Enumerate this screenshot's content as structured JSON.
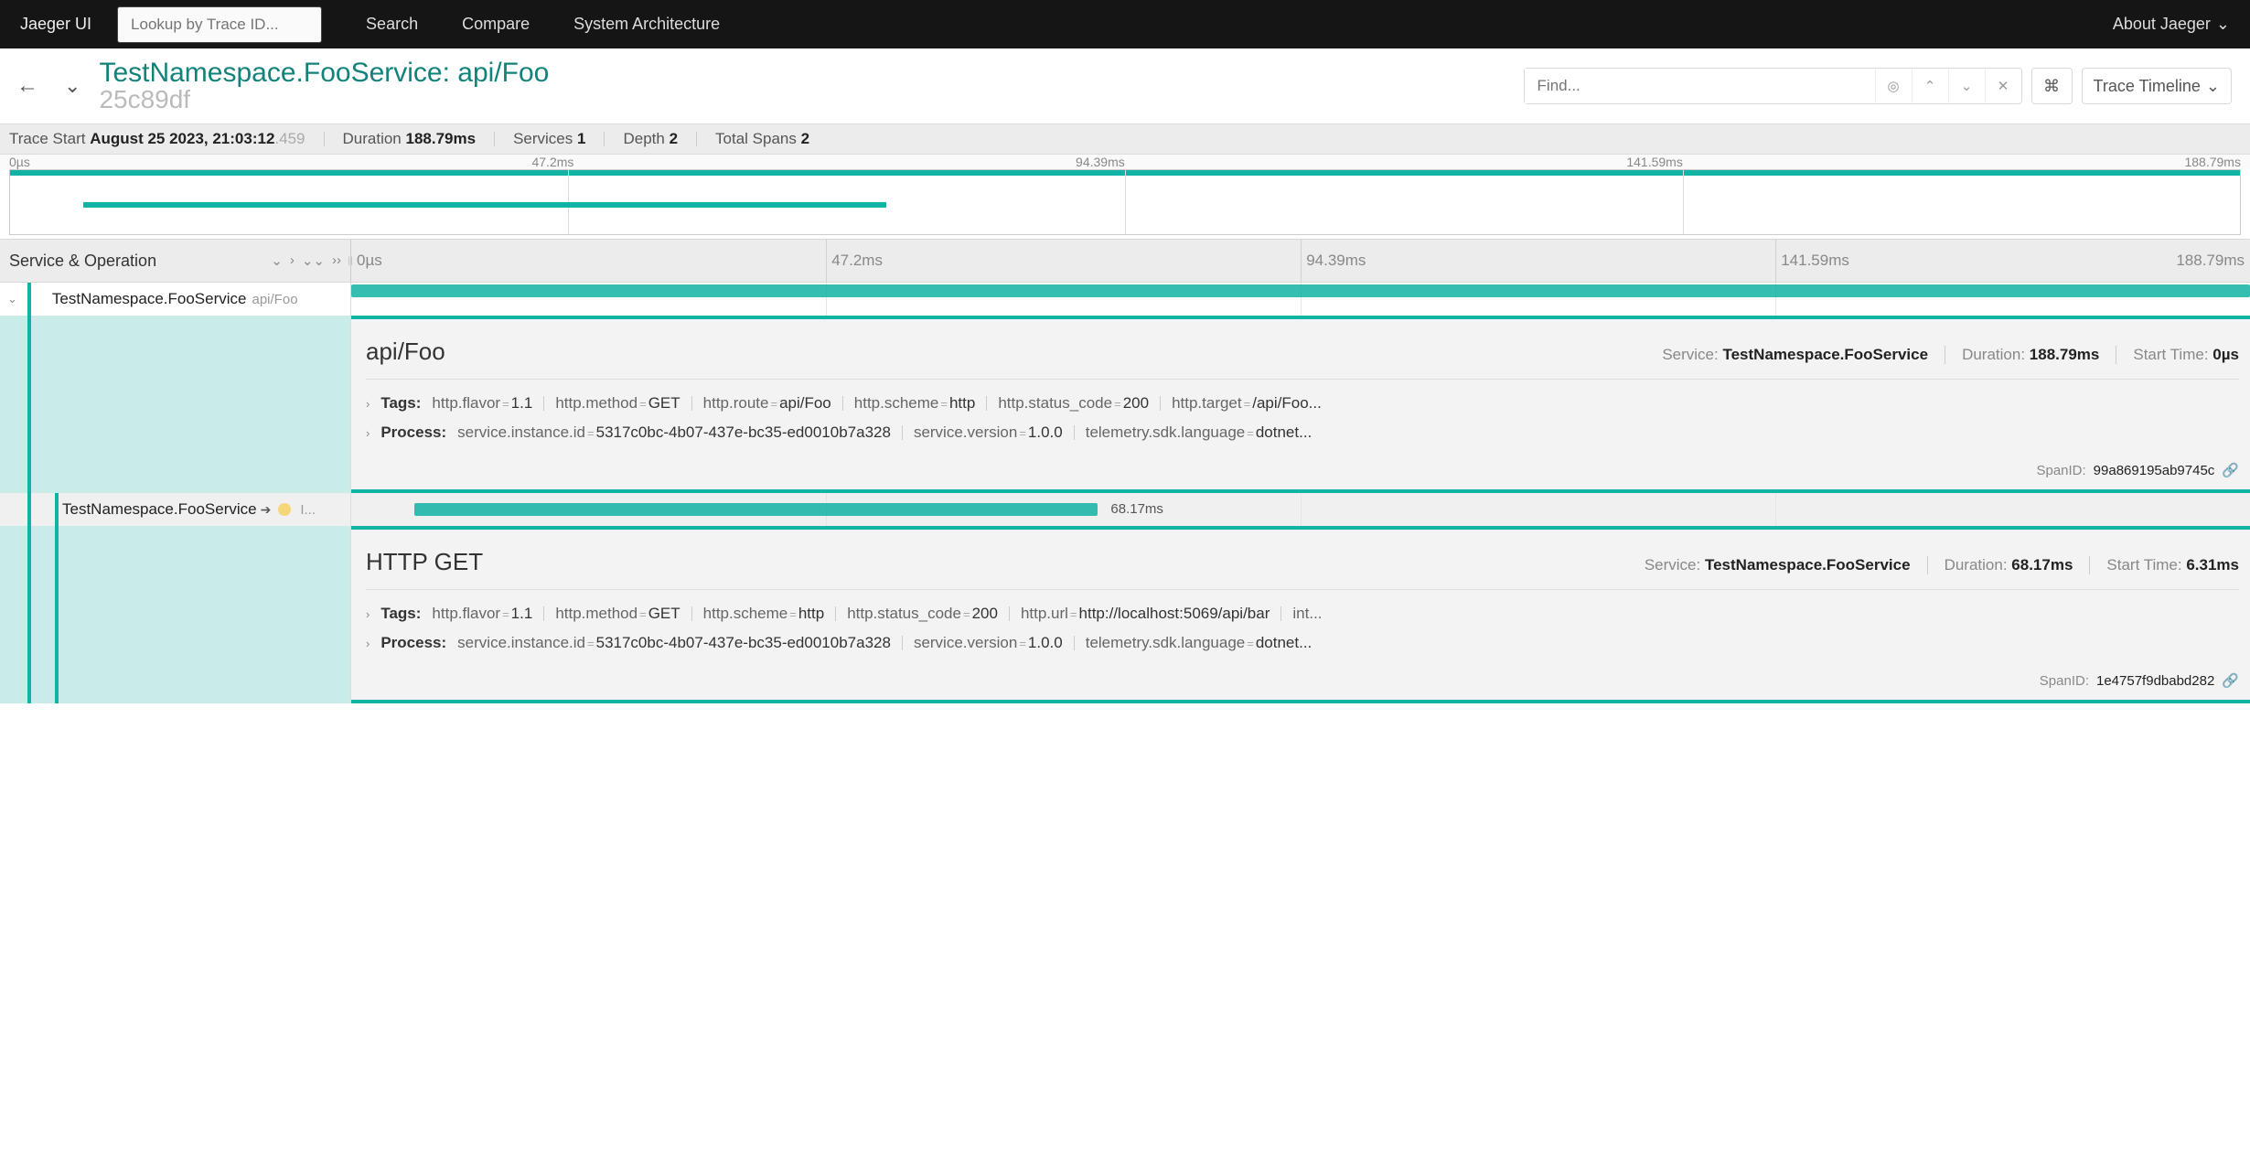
{
  "nav": {
    "brand": "Jaeger UI",
    "lookup_placeholder": "Lookup by Trace ID...",
    "links": [
      "Search",
      "Compare",
      "System Architecture"
    ],
    "about": "About Jaeger"
  },
  "header": {
    "service_op": "TestNamespace.FooService: api/Foo",
    "trace_id_short": "25c89df",
    "find_placeholder": "Find...",
    "kbd": "⌘",
    "view_label": "Trace Timeline"
  },
  "meta": {
    "trace_start_label": "Trace Start",
    "trace_start_value": "August 25 2023, 21:03:12",
    "trace_start_frac": ".459",
    "duration_label": "Duration",
    "duration_value": "188.79ms",
    "services_label": "Services",
    "services_value": "1",
    "depth_label": "Depth",
    "depth_value": "2",
    "total_spans_label": "Total Spans",
    "total_spans_value": "2"
  },
  "ticks": [
    "0µs",
    "47.2ms",
    "94.39ms",
    "141.59ms",
    "188.79ms"
  ],
  "tree": {
    "heading": "Service & Operation"
  },
  "spans": [
    {
      "service": "TestNamespace.FooService",
      "operation": "api/Foo",
      "detail": {
        "title": "api/Foo",
        "service_label": "Service:",
        "service": "TestNamespace.FooService",
        "duration_label": "Duration:",
        "duration": "188.79ms",
        "start_label": "Start Time:",
        "start": "0µs",
        "tags_label": "Tags:",
        "tags": [
          {
            "k": "http.flavor",
            "v": "1.1"
          },
          {
            "k": "http.method",
            "v": "GET"
          },
          {
            "k": "http.route",
            "v": "api/Foo"
          },
          {
            "k": "http.scheme",
            "v": "http"
          },
          {
            "k": "http.status_code",
            "v": "200"
          },
          {
            "k": "http.target",
            "v": "/api/Foo..."
          }
        ],
        "process_label": "Process:",
        "process": [
          {
            "k": "service.instance.id",
            "v": "5317c0bc-4b07-437e-bc35-ed0010b7a328"
          },
          {
            "k": "service.version",
            "v": "1.0.0"
          },
          {
            "k": "telemetry.sdk.language",
            "v": "dotnet..."
          }
        ],
        "span_id_label": "SpanID:",
        "span_id": "99a869195ab9745c"
      }
    },
    {
      "service": "TestNamespace.FooService",
      "operation_short": "I...",
      "bar_label": "68.17ms",
      "detail": {
        "title": "HTTP GET",
        "service_label": "Service:",
        "service": "TestNamespace.FooService",
        "duration_label": "Duration:",
        "duration": "68.17ms",
        "start_label": "Start Time:",
        "start": "6.31ms",
        "tags_label": "Tags:",
        "tags": [
          {
            "k": "http.flavor",
            "v": "1.1"
          },
          {
            "k": "http.method",
            "v": "GET"
          },
          {
            "k": "http.scheme",
            "v": "http"
          },
          {
            "k": "http.status_code",
            "v": "200"
          },
          {
            "k": "http.url",
            "v": "http://localhost:5069/api/bar"
          },
          {
            "k": "int...",
            "v": ""
          }
        ],
        "process_label": "Process:",
        "process": [
          {
            "k": "service.instance.id",
            "v": "5317c0bc-4b07-437e-bc35-ed0010b7a328"
          },
          {
            "k": "service.version",
            "v": "1.0.0"
          },
          {
            "k": "telemetry.sdk.language",
            "v": "dotnet..."
          }
        ],
        "span_id_label": "SpanID:",
        "span_id": "1e4757f9dbabd282"
      }
    }
  ]
}
